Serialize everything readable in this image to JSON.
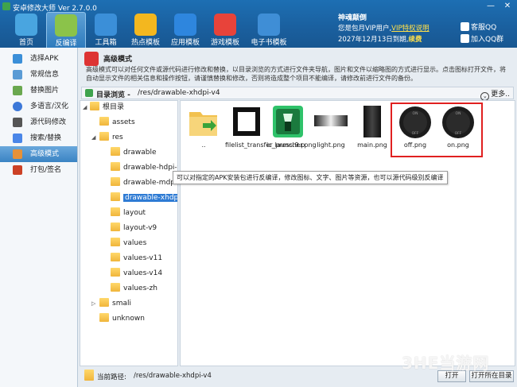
{
  "window": {
    "title": "安卓修改大师 Ver 2.7.0.0",
    "min": "—",
    "close": "✕"
  },
  "nav": [
    {
      "label": "首页",
      "icon": "home-icon",
      "color": "#49a5e0"
    },
    {
      "label": "反编译",
      "icon": "android-icon",
      "color": "#8bc34a"
    },
    {
      "label": "工具箱",
      "icon": "toolbox-icon",
      "color": "#3b8fd8"
    },
    {
      "label": "热点模板",
      "icon": "star-icon",
      "color": "#f3b71f"
    },
    {
      "label": "应用模板",
      "icon": "grid-icon",
      "color": "#2e86de"
    },
    {
      "label": "游戏模板",
      "icon": "game-icon",
      "color": "#e8433a"
    },
    {
      "label": "电子书模板",
      "icon": "book-icon",
      "color": "#3f8ed6"
    }
  ],
  "vip": {
    "title": "神魂颠倒",
    "line1_pre": "您是包月VIP用户,",
    "line1_link": "VIP特权说明",
    "line2_pre": "2027年12月13日到期,",
    "line2_link": "续费",
    "qq1": "客服QQ",
    "qq2": "加入QQ群"
  },
  "sidebar": [
    {
      "label": "选择APK",
      "color": "#3b8fd8"
    },
    {
      "label": "常规信息",
      "color": "#5a9bd5"
    },
    {
      "label": "替换图片",
      "color": "#6aa84f"
    },
    {
      "label": "多语言/汉化",
      "color": "#3c78d8"
    },
    {
      "label": "源代码修改",
      "color": "#555555"
    },
    {
      "label": "搜索/替换",
      "color": "#4a86e8"
    },
    {
      "label": "高级模式",
      "color": "#e69138"
    },
    {
      "label": "打包/签名",
      "color": "#cc4125"
    }
  ],
  "desc": {
    "title": "高级模式",
    "text": "高级模式可以对任何文件或源代码进行修改和替换，以目录浏览的方式进行文件夹导航，图片和文件以缩略图的方式进行显示。点击图标打开文件，将自动显示文件的相关信息和操作按钮，请谨慎替换和修改，否则将造成整个项目不能编译，请修改前进行文件的备份。"
  },
  "browser": {
    "label": "目录浏览 -",
    "path": "/res/drawable-xhdpi-v4",
    "more": "更多.."
  },
  "tree": [
    {
      "label": "根目录",
      "level": 0,
      "expanded": true
    },
    {
      "label": "assets",
      "level": 1
    },
    {
      "label": "res",
      "level": 1,
      "expanded": true
    },
    {
      "label": "drawable",
      "level": 2
    },
    {
      "label": "drawable-hdpi-v4",
      "level": 2
    },
    {
      "label": "drawable-mdpi-v4",
      "level": 2
    },
    {
      "label": "drawable-xhdpi-v4",
      "level": 2,
      "selected": true
    },
    {
      "label": "layout",
      "level": 2
    },
    {
      "label": "layout-v9",
      "level": 2
    },
    {
      "label": "values",
      "level": 2
    },
    {
      "label": "values-v11",
      "level": 2
    },
    {
      "label": "values-v14",
      "level": 2
    },
    {
      "label": "values-zh",
      "level": 2
    },
    {
      "label": "smali",
      "level": 1,
      "collapsed": true
    },
    {
      "label": "unknown",
      "level": 1
    }
  ],
  "files": [
    {
      "name": "..",
      "kind": "up-folder"
    },
    {
      "name": "filelist_transfer_press.9.p",
      "kind": "frame"
    },
    {
      "name": "ic_launcher.png",
      "kind": "launcher"
    },
    {
      "name": "light.png",
      "kind": "light"
    },
    {
      "name": "main.png",
      "kind": "main"
    },
    {
      "name": "off.png",
      "kind": "switch-off"
    },
    {
      "name": "on.png",
      "kind": "switch-on"
    }
  ],
  "switch_text": {
    "on": "ON",
    "off": "OFF"
  },
  "tooltip": "可以对指定的APK安装包进行反编译，修改图标、文字、图片等资源，也可以源代码级别反编译",
  "bottom": {
    "label": "当前路径:",
    "path": "/res/drawable-xhdpi-v4",
    "open": "打开",
    "open_dir": "打开所在目录"
  },
  "watermark": "3HE当游网"
}
